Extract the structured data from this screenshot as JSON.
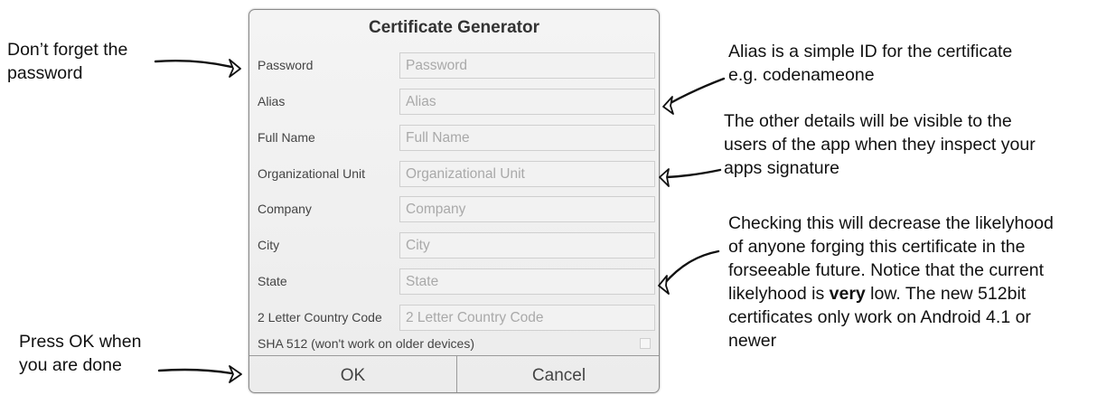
{
  "notes": {
    "password": [
      "Don’t forget the",
      "password"
    ],
    "ok": [
      "Press OK when",
      "you are done"
    ],
    "alias": [
      "Alias is a simple ID for the certificate",
      "e.g. codenameone"
    ],
    "other": [
      "The other details will be visible to the",
      "users of the app when they inspect your",
      "apps signature"
    ],
    "sha": {
      "line1": "Checking this will decrease the likelyhood",
      "line2": "of anyone forging this certificate in the",
      "line3": "forseeable future. Notice that the current",
      "line4_before": "likelyhood is ",
      "line4_bold": "very",
      "line4_after": " low. The new 512bit",
      "line5": "certificates only work on Android 4.1 or",
      "line6": "newer"
    }
  },
  "dialog": {
    "title": "Certificate Generator",
    "fields": [
      {
        "label": "Password",
        "placeholder": "Password",
        "value": ""
      },
      {
        "label": "Alias",
        "placeholder": "Alias",
        "value": ""
      },
      {
        "label": "Full Name",
        "placeholder": "Full Name",
        "value": ""
      },
      {
        "label": "Organizational Unit",
        "placeholder": "Organizational Unit",
        "value": ""
      },
      {
        "label": "Company",
        "placeholder": "Company",
        "value": ""
      },
      {
        "label": "City",
        "placeholder": "City",
        "value": ""
      },
      {
        "label": "State",
        "placeholder": "State",
        "value": ""
      },
      {
        "label": "2 Letter Country Code",
        "placeholder": "2 Letter Country Code",
        "value": ""
      }
    ],
    "sha_label": "SHA 512 (won't work on older devices)",
    "sha_checked": false,
    "ok_label": "OK",
    "cancel_label": "Cancel"
  },
  "arrow_icon": "hand-drawn-arrow-icon"
}
